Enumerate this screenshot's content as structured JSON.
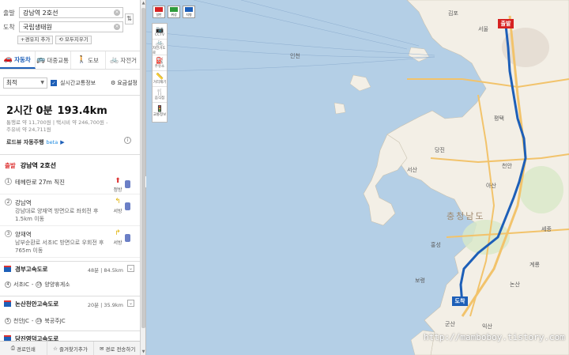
{
  "search": {
    "origin_label": "출발",
    "origin_value": "강남역 2호선",
    "dest_label": "도착",
    "dest_value": "국립생태원",
    "add_waypoint": "+경유지 추가",
    "clear_all": "모두지우기"
  },
  "modes": [
    {
      "label": "자동차",
      "icon": "car-icon"
    },
    {
      "label": "대중교통",
      "icon": "bus-icon"
    },
    {
      "label": "도보",
      "icon": "walk-icon"
    },
    {
      "label": "자전거",
      "icon": "bike-icon"
    }
  ],
  "options": {
    "route_type": "최적",
    "realtime_label": "실시간교통정보",
    "fare_info": "요금설정"
  },
  "summary": {
    "time": "2시간 0분",
    "distance": "193.4km",
    "fare_line1": "통행료 약 11,700원 | 택시비 약 246,700원 -",
    "fare_line2": "주유비 약 24,711원",
    "roadview_label": "로드뷰 자동주행",
    "roadview_beta": "beta"
  },
  "start": {
    "tag": "출발",
    "name": "강남역 2호선"
  },
  "steps": [
    {
      "num": "1",
      "main": "테헤란로 27m 직진",
      "sub": "",
      "turn_label": "정방"
    },
    {
      "num": "2",
      "main": "강남역",
      "sub": "강남대로 양재역 방면으로 좌회전 후 1.5km 이동",
      "turn_label": "서방"
    },
    {
      "num": "3",
      "main": "양재역",
      "sub": "남부순환로 서초IC 방면으로 우회전 후 765m 이동",
      "turn_label": "서방"
    }
  ],
  "highways": [
    {
      "name": "경부고속도로",
      "time": "48분",
      "dist": "84.5km",
      "from_num": "4",
      "from": "서초IC",
      "to_num": "15",
      "to": "양양휴게소"
    },
    {
      "name": "논산천안고속도로",
      "time": "20분",
      "dist": "35.9km",
      "from_num": "5",
      "from": "천안JC",
      "to_num": "19",
      "to": "북공주JC"
    },
    {
      "name": "당진영덕고속도로",
      "time": "",
      "dist": "",
      "from_num": "",
      "from": "",
      "to_num": "",
      "to": ""
    }
  ],
  "bottom_bar": {
    "print": "경로인쇄",
    "favorite": "즐겨찾기추가",
    "send": "경로 전송하기"
  },
  "map": {
    "start_marker": "출발",
    "end_marker": "도착",
    "watermark": "http://mamboboy.tistory.com",
    "labels": [
      {
        "text": "인천",
        "cls": ""
      },
      {
        "text": "서울",
        "cls": ""
      },
      {
        "text": "천안",
        "cls": ""
      },
      {
        "text": "세종",
        "cls": ""
      },
      {
        "text": "충청남도",
        "cls": "big"
      },
      {
        "text": "당진",
        "cls": ""
      },
      {
        "text": "서산",
        "cls": ""
      },
      {
        "text": "홍성",
        "cls": ""
      },
      {
        "text": "보령",
        "cls": ""
      },
      {
        "text": "논산",
        "cls": ""
      },
      {
        "text": "계룡",
        "cls": ""
      },
      {
        "text": "군산",
        "cls": ""
      },
      {
        "text": "익산",
        "cls": ""
      },
      {
        "text": "김포",
        "cls": ""
      },
      {
        "text": "평택",
        "cls": ""
      },
      {
        "text": "아산",
        "cls": ""
      }
    ]
  },
  "toolbar": {
    "layers": [
      "일반",
      "위성",
      "지형"
    ],
    "tools": [
      "CCTV",
      "자전거도로",
      "주유소",
      "거리재기",
      "음식점",
      "교통정보"
    ]
  },
  "colors": {
    "route": "#1d5fb8",
    "start": "#d62222",
    "land": "#f3efe6",
    "sea": "#b4cfe6",
    "expressway": "#f2c36b"
  }
}
